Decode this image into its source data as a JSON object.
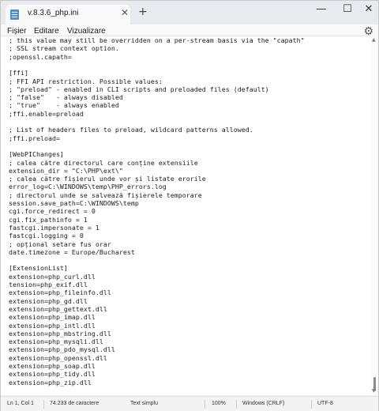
{
  "tab": {
    "title": "v.8.3.6_php.ini",
    "close": "✕",
    "new": "+"
  },
  "window_controls": {
    "minimize": "—",
    "maximize": "☐",
    "close": "✕"
  },
  "menu": {
    "file": "Fișier",
    "edit": "Editare",
    "view": "Vizualizare"
  },
  "editor": {
    "lines": [
      "; this value may still be overridden on a per-stream basis via the \"capath\"",
      "; SSL stream context option.",
      ";openssl.capath=",
      "",
      "[ffi]",
      "; FFI API restriction. Possible values:",
      "; \"preload\" - enabled in CLI scripts and preloaded files (default)",
      "; \"false\"   - always disabled",
      "; \"true\"    - always enabled",
      ";ffi.enable=preload",
      "",
      "; List of headers files to preload, wildcard patterns allowed.",
      ";ffi.preload=",
      "",
      "[WebPIChanges]",
      "; calea către directorul care conține extensiile",
      "extension_dir = \"C:\\PHP\\ext\\\"",
      "; calea către fișierul unde vor și listate erorile",
      "error_log=C:\\WINDOWS\\temp\\PHP_errors.log",
      "; directorul unde se salvează fișierele temporare",
      "session.save_path=C:\\WINDOWS\\temp",
      "cgi.force_redirect = 0",
      "cgi.fix_pathinfo = 1",
      "fastcgi.impersonate = 1",
      "fastcgi.logging = 0",
      "; opțional setare fus orar",
      "date.timezone = Europe/Bucharest",
      "",
      "[ExtensionList]",
      "extension=php_curl.dll",
      "tension=php_exif.dll",
      "extension=php_fileinfo.dll",
      "extension=php_gd.dll",
      "extension=php_gettext.dll",
      "extension=php_imap.dll",
      "extension=php_intl.dll",
      "extension=php_mbstring.dll",
      "extension=php_mysqli.dll",
      "extension=php_pdo_mysql.dll",
      "extension=php_openssl.dll",
      "extension=php_soap.dll",
      "extension=php_tidy.dll",
      "extension=php_zip.dll"
    ]
  },
  "status": {
    "position": "Ln 1, Col 1",
    "chars": "74.233 de caractere",
    "format": "Text simplu",
    "zoom": "100%",
    "line_ending": "Windows (CRLF)",
    "encoding": "UTF-8"
  }
}
